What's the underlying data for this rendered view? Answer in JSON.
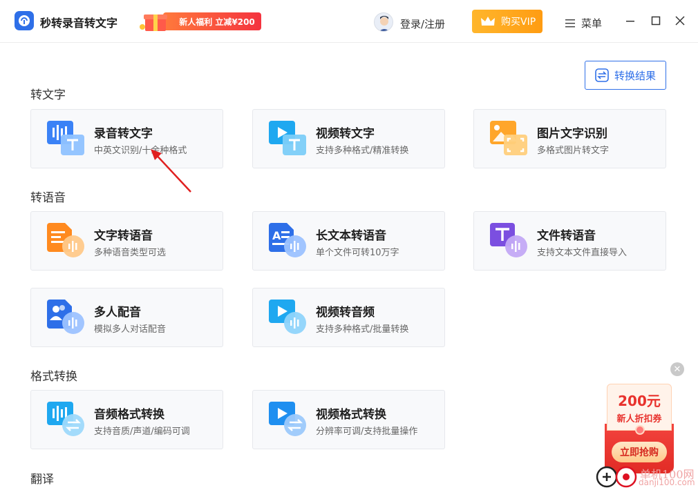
{
  "app": {
    "title": "秒转录音转文字"
  },
  "promo": {
    "text": "新人福利 立减¥200"
  },
  "header": {
    "login": "登录/注册",
    "vip": "购买VIP",
    "menu": "菜单"
  },
  "result_button": {
    "label": "转换结果"
  },
  "sections": {
    "to_text": "转文字",
    "to_speech": "转语音",
    "format": "格式转换",
    "translate": "翻译"
  },
  "cards": {
    "audio_to_text": {
      "title": "录音转文字",
      "desc": "中英文识别/十余种格式"
    },
    "video_to_text": {
      "title": "视频转文字",
      "desc": "支持多种格式/精准转换"
    },
    "image_ocr": {
      "title": "图片文字识别",
      "desc": "多格式图片转文字"
    },
    "text_to_speech": {
      "title": "文字转语音",
      "desc": "多种语音类型可选"
    },
    "long_text_to_speech": {
      "title": "长文本转语音",
      "desc": "单个文件可转10万字"
    },
    "file_to_speech": {
      "title": "文件转语音",
      "desc": "支持文本文件直接导入"
    },
    "multi_dub": {
      "title": "多人配音",
      "desc": "模拟多人对话配音"
    },
    "video_to_audio": {
      "title": "视频转音频",
      "desc": "支持多种格式/批量转换"
    },
    "audio_format": {
      "title": "音频格式转换",
      "desc": "支持音质/声道/编码可调"
    },
    "video_format": {
      "title": "视频格式转换",
      "desc": "分辨率可调/支持批量操作"
    }
  },
  "coupon": {
    "amount": "200元",
    "label": "新人折扣券",
    "button": "立即抢购"
  },
  "watermark": {
    "line1": "单机100网",
    "line2": "danji100.com"
  },
  "colors": {
    "accent": "#2e6fe8",
    "vip": "#ffa81f",
    "promo": "#f4333f"
  }
}
